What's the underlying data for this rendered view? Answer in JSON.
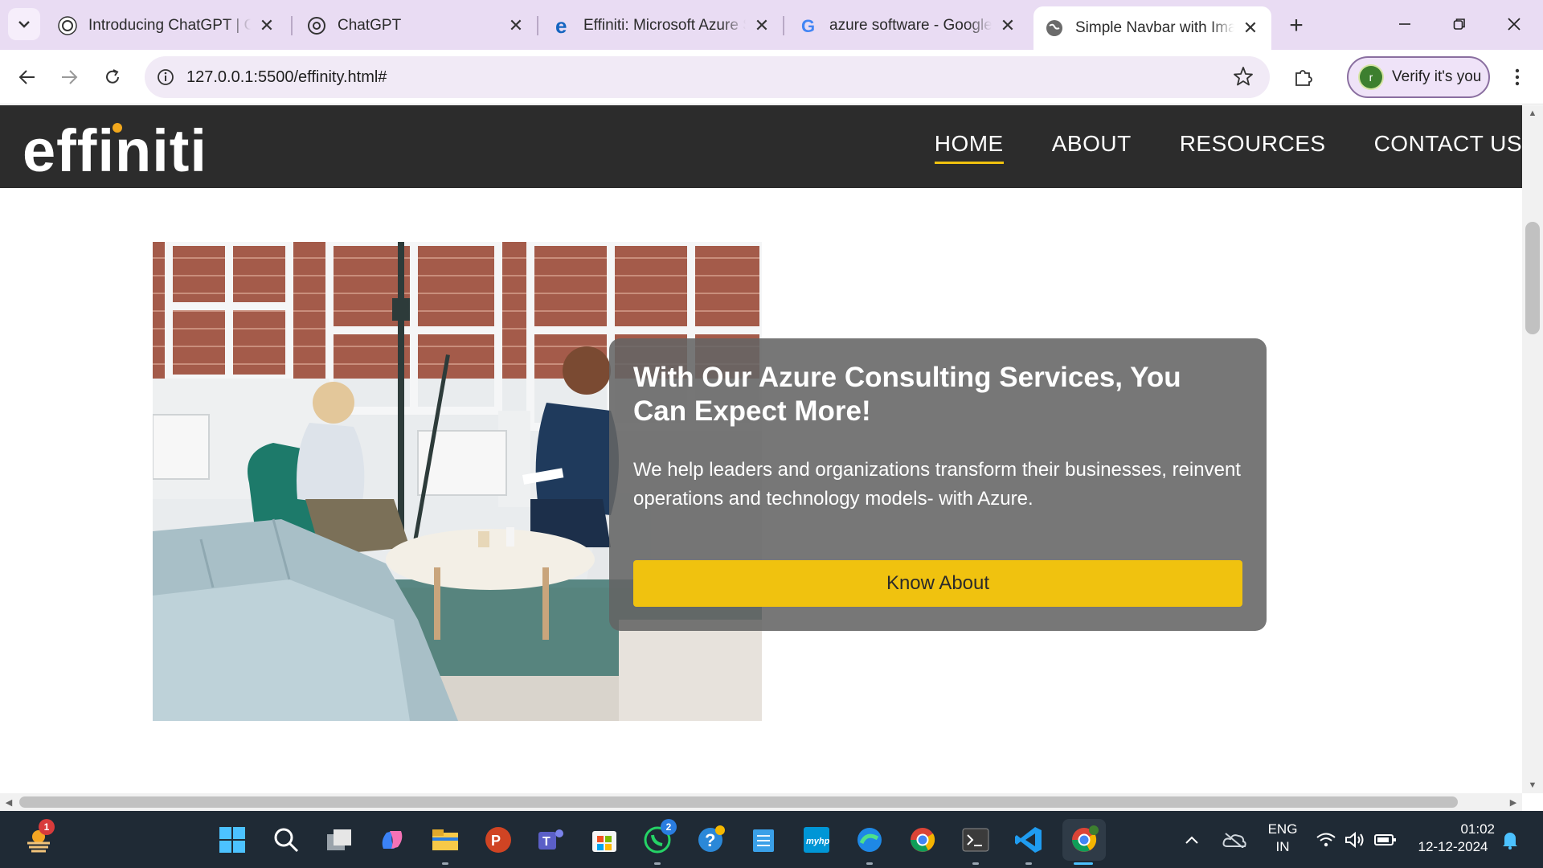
{
  "browser": {
    "tabs": [
      {
        "title": "Introducing ChatGPT | Op",
        "favicon": "openai-icon",
        "active": false
      },
      {
        "title": "ChatGPT",
        "favicon": "openai-icon",
        "active": false
      },
      {
        "title": "Effiniti: Microsoft Azure S",
        "favicon": "edge-e-icon",
        "active": false
      },
      {
        "title": "azure software - Google S",
        "favicon": "google-icon",
        "active": false
      },
      {
        "title": "Simple Navbar with Imag",
        "favicon": "globe-icon",
        "active": true
      }
    ],
    "address": "127.0.0.1:5500/effinity.html#",
    "profile_button": "Verify it's you",
    "profile_initial": "r"
  },
  "site": {
    "logo": "effiniti",
    "nav": [
      {
        "label": "HOME",
        "active": true
      },
      {
        "label": "ABOUT",
        "active": false
      },
      {
        "label": "RESOURCES",
        "active": false
      },
      {
        "label": "CONTACT US",
        "active": false
      }
    ],
    "hero": {
      "heading": "With Our Azure Consulting Services, You Can Expect More!",
      "text": "We help leaders and organizations transform their businesses, reinvent operations and technology models- with Azure.",
      "button": "Know About"
    }
  },
  "taskbar": {
    "badges": {
      "weather": "1",
      "whatsapp": "2"
    },
    "language": [
      "ENG",
      "IN"
    ],
    "time": "01:02",
    "date": "12-12-2024"
  },
  "colors": {
    "accent_yellow": "#f0c20f",
    "nav_bg": "#2c2c2c",
    "tabstrip": "#e9dcf3"
  }
}
